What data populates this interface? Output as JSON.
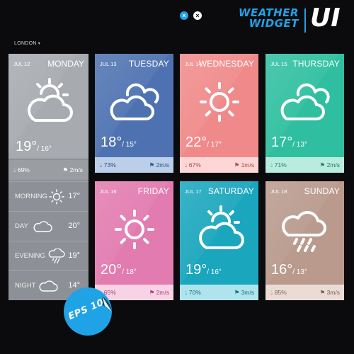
{
  "header": {
    "brand_line1": "WEATHER",
    "brand_line2": "WIDGET",
    "brand_ui": "UI",
    "btn1_glyph": "×",
    "btn2_glyph": "×"
  },
  "location": {
    "name": "LONDON",
    "caret": "▾"
  },
  "today": {
    "date": "JUL 12",
    "day": "MONDAY",
    "icon": "partly-cloudy-icon",
    "temp_high": "19°",
    "temp_low": "/ 16°",
    "humidity": "69%",
    "wind": "2m/s",
    "color": "#a7aaaf",
    "periods": [
      {
        "name": "MORNING",
        "icon": "sun-icon",
        "temp": "17°"
      },
      {
        "name": "DAY",
        "icon": "cloud-icon",
        "temp": "20°"
      },
      {
        "name": "EVENING",
        "icon": "rain-icon",
        "temp": "19°"
      },
      {
        "name": "NIGHT",
        "icon": "cloud-icon",
        "temp": "14°"
      }
    ]
  },
  "forecast": [
    {
      "date": "JUL 13",
      "day": "TUESDAY",
      "icon": "cloudy-icon",
      "temp_high": "18°",
      "temp_low": "/ 15°",
      "humidity": "73%",
      "wind": "2m/s",
      "color": "#4e72b1",
      "stats_color": "#bccfe8",
      "text_color": "#2c4f88"
    },
    {
      "date": "JUL 14",
      "day": "WEDNESDAY",
      "icon": "sun-icon",
      "temp_high": "22°",
      "temp_low": "/ 17°",
      "humidity": "67%",
      "wind": "1m/s",
      "color": "#f08a8a",
      "stats_color": "#ffd6d6",
      "text_color": "#a94848"
    },
    {
      "date": "JUL 15",
      "day": "THURSDAY",
      "icon": "cloudy-icon",
      "temp_high": "17°",
      "temp_low": "/ 13°",
      "humidity": "71%",
      "wind": "2m/s",
      "color": "#2fbfa0",
      "stats_color": "#b9ecdf",
      "text_color": "#1b7c66"
    },
    {
      "date": "JUL 16",
      "day": "FRIDAY",
      "icon": "sun-icon",
      "temp_high": "20°",
      "temp_low": "/ 18°",
      "humidity": "65%",
      "wind": "2m/s",
      "color": "#e27bb0",
      "stats_color": "#f8d3e6",
      "text_color": "#a0437a"
    },
    {
      "date": "JUL 17",
      "day": "SATURDAY",
      "icon": "partly-cloudy-icon",
      "temp_high": "19°",
      "temp_low": "/ 16°",
      "humidity": "70%",
      "wind": "3m/s",
      "color": "#1aa6bd",
      "stats_color": "#b0e4ed",
      "text_color": "#11707f"
    },
    {
      "date": "JUL 18",
      "day": "SUNDAY",
      "icon": "rain-icon",
      "temp_high": "16°",
      "temp_low": "/ 13°",
      "humidity": "85%",
      "wind": "3m/s",
      "color": "#b99a8d",
      "stats_color": "#eadcd5",
      "text_color": "#7a5d51"
    }
  ],
  "badge": {
    "text": "EPS 10",
    "color": "#1fa3e6"
  }
}
